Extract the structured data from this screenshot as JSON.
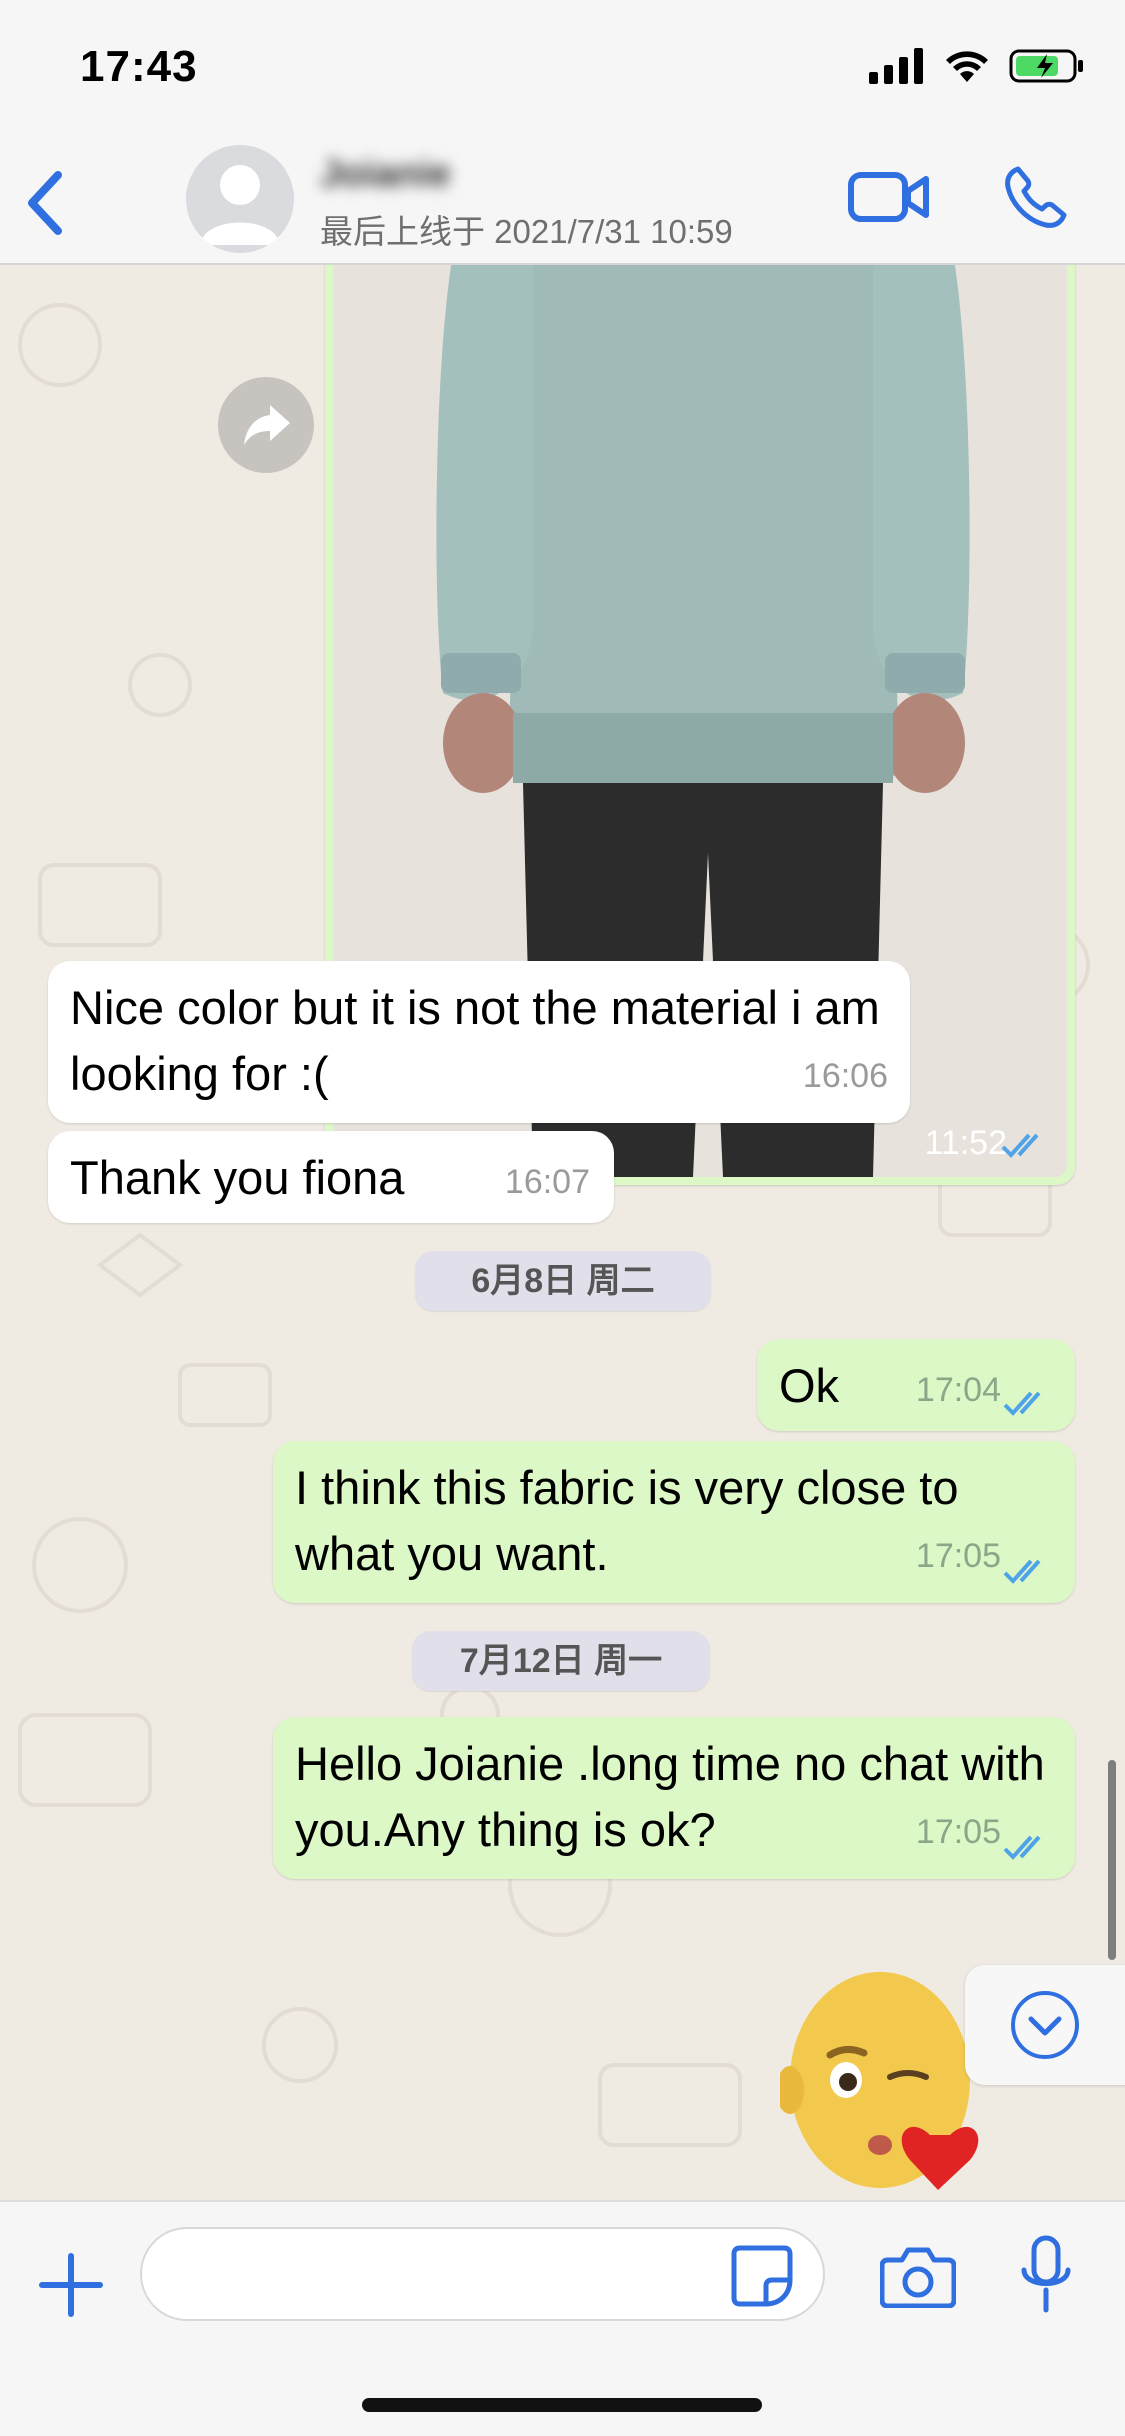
{
  "status_bar": {
    "time": "17:43"
  },
  "header": {
    "contact_name": "Joianie",
    "last_seen": "最后上线于 2021/7/31 10:59"
  },
  "messages": [
    {
      "type": "photo",
      "direction": "outgoing",
      "time": "11:52",
      "read": true
    },
    {
      "direction": "incoming",
      "text": "Nice color but it is not the material i am looking for :(",
      "time": "16:06"
    },
    {
      "direction": "incoming",
      "text": "Thank you fiona",
      "time": "16:07"
    },
    {
      "type": "date",
      "text": "6月8日 周二"
    },
    {
      "direction": "outgoing",
      "text": "Ok",
      "time": "17:04",
      "read": true
    },
    {
      "direction": "outgoing",
      "text": "I think this fabric is very close to what you want.",
      "time": "17:05",
      "read": true
    },
    {
      "type": "date",
      "text": "7月12日 周一"
    },
    {
      "direction": "outgoing",
      "text": "Hello Joianie .long time no chat with you.Any thing is ok?",
      "time": "17:05",
      "read": true
    }
  ],
  "input": {
    "placeholder": "",
    "value": ""
  },
  "colors": {
    "accent": "#2f6fe0",
    "outgoing_bubble": "#dcf8c6",
    "incoming_bubble": "#ffffff",
    "read_ticks": "#4fa3e8",
    "chat_background": "#efeae2"
  }
}
